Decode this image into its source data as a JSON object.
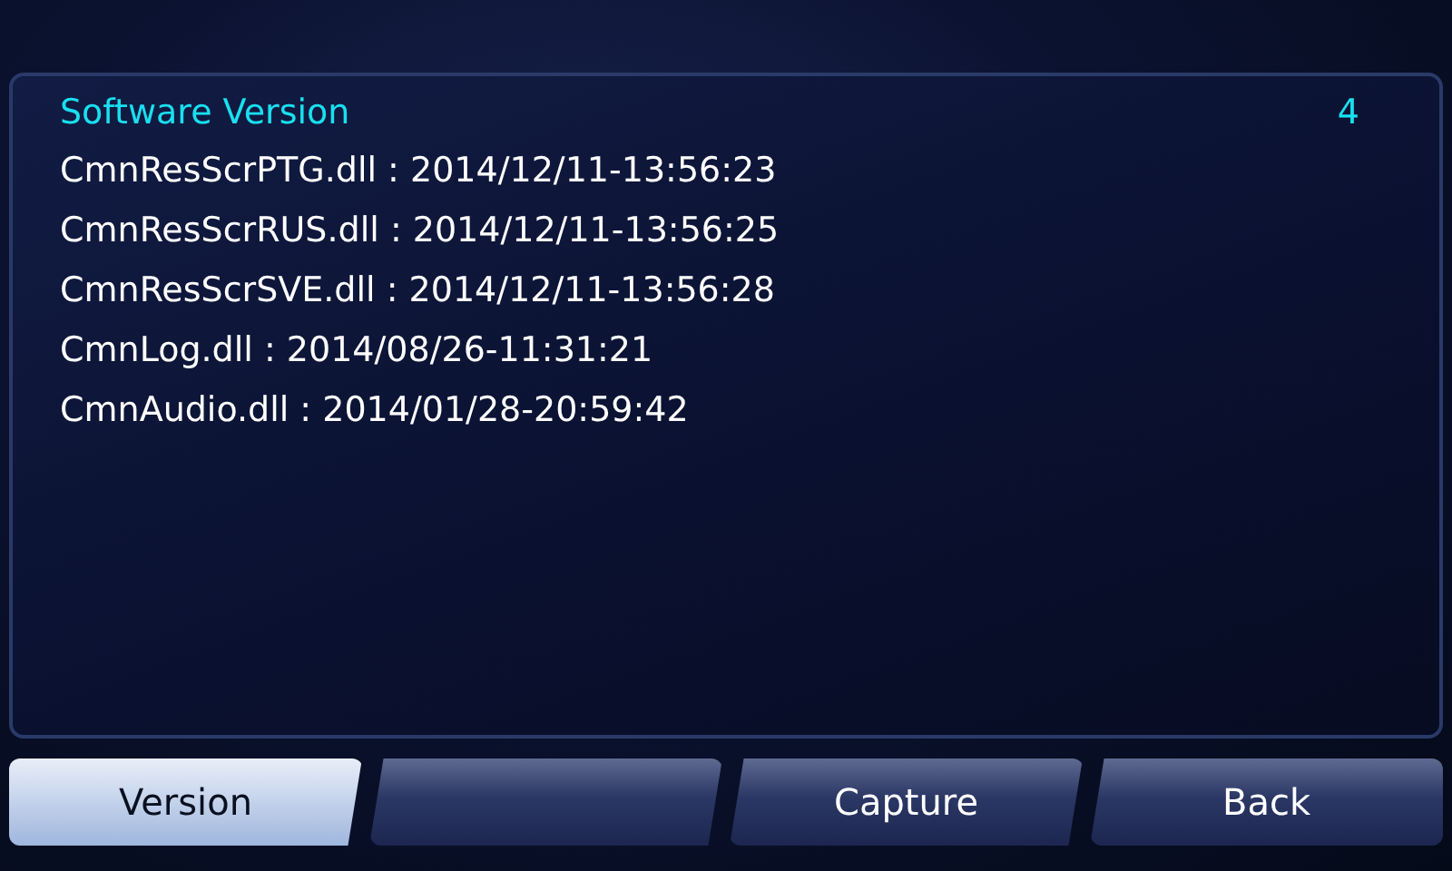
{
  "panel": {
    "title": "Software Version",
    "page": "4",
    "rows": [
      "CmnResScrPTG.dll : 2014/12/11-13:56:23",
      "CmnResScrRUS.dll : 2014/12/11-13:56:25",
      "CmnResScrSVE.dll : 2014/12/11-13:56:28",
      "CmnLog.dll : 2014/08/26-11:31:21",
      "CmnAudio.dll : 2014/01/28-20:59:42"
    ]
  },
  "buttons": [
    {
      "label": "Version",
      "selected": true
    },
    {
      "selected": false
    },
    {
      "label": "Capture",
      "selected": false
    },
    {
      "label": "Back",
      "selected": false
    }
  ]
}
